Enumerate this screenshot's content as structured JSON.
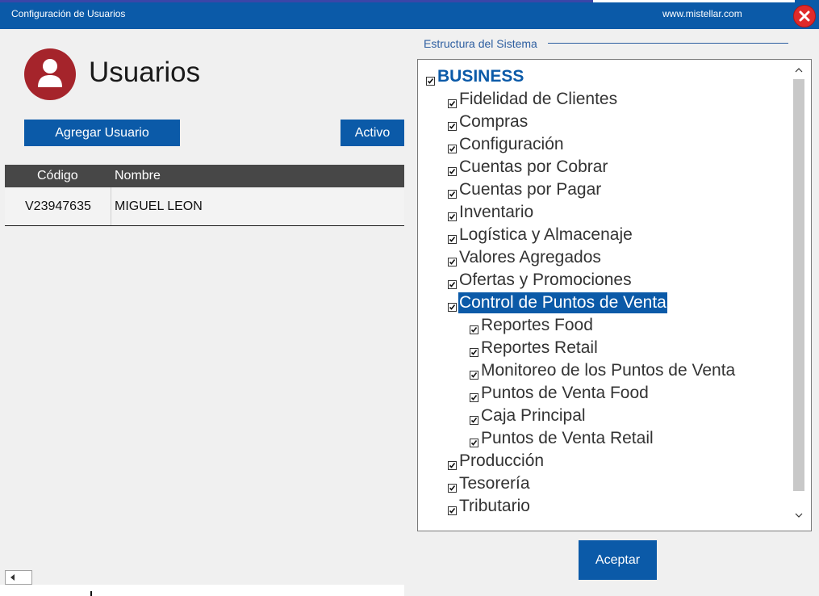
{
  "window": {
    "title": "Configuración de Usuarios",
    "site": "www.mistellar.com"
  },
  "left": {
    "page_title": "Usuarios",
    "add_user_label": "Agregar Usuario",
    "active_label": "Activo",
    "table": {
      "columns": [
        "Código",
        "Nombre"
      ],
      "rows": [
        {
          "code": "V23947635",
          "name": "MIGUEL LEON"
        }
      ]
    }
  },
  "right": {
    "section_label": "Estructura del Sistema",
    "tree": [
      {
        "label": "BUSINESS",
        "level": 0,
        "checked": true,
        "root": true
      },
      {
        "label": "Fidelidad de Clientes",
        "level": 1,
        "checked": true
      },
      {
        "label": "Compras",
        "level": 1,
        "checked": true
      },
      {
        "label": "Configuración",
        "level": 1,
        "checked": true
      },
      {
        "label": "Cuentas por Cobrar",
        "level": 1,
        "checked": true
      },
      {
        "label": "Cuentas por Pagar",
        "level": 1,
        "checked": true
      },
      {
        "label": "Inventario",
        "level": 1,
        "checked": true
      },
      {
        "label": "Logística y Almacenaje",
        "level": 1,
        "checked": true
      },
      {
        "label": "Valores Agregados",
        "level": 1,
        "checked": true
      },
      {
        "label": "Ofertas y Promociones",
        "level": 1,
        "checked": true
      },
      {
        "label": "Control de Puntos de Venta",
        "level": 1,
        "checked": true,
        "selected": true
      },
      {
        "label": "Reportes Food",
        "level": 2,
        "checked": true
      },
      {
        "label": "Reportes Retail",
        "level": 2,
        "checked": true
      },
      {
        "label": "Monitoreo de los Puntos de Venta",
        "level": 2,
        "checked": true
      },
      {
        "label": "Puntos de Venta Food",
        "level": 2,
        "checked": true
      },
      {
        "label": "Caja Principal",
        "level": 2,
        "checked": true
      },
      {
        "label": "Puntos de Venta Retail",
        "level": 2,
        "checked": true
      },
      {
        "label": "Producción",
        "level": 1,
        "checked": true
      },
      {
        "label": "Tesorería",
        "level": 1,
        "checked": true
      },
      {
        "label": "Tributario",
        "level": 1,
        "checked": true
      }
    ],
    "accept_label": "Aceptar"
  },
  "colors": {
    "primary": "#0b5aa8",
    "avatar": "#a5242b",
    "close": "#e02a2a",
    "table_header": "#474747"
  }
}
